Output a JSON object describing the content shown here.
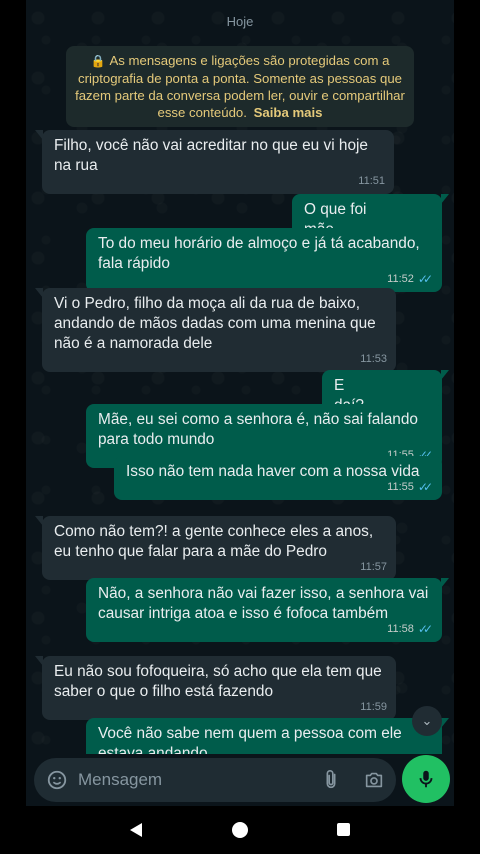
{
  "date_label": "Hoje",
  "encryption_notice": {
    "text": "As mensagens e ligações são protegidas com a criptografia de ponta a ponta. Somente as pessoas que fazem parte da conversa podem ler, ouvir e compartilhar esse conteúdo.",
    "link": "Saiba mais"
  },
  "messages": [
    {
      "direction": "in",
      "text": "Filho, você não vai acreditar no que eu vi hoje na rua",
      "time": "11:51"
    },
    {
      "direction": "out",
      "text": "O que foi mãe",
      "time": "11:51"
    },
    {
      "direction": "out",
      "text": "To do meu horário de almoço e já tá acabando, fala rápido",
      "time": "11:52"
    },
    {
      "direction": "in",
      "text": "Vi o Pedro, filho da moça ali da rua de baixo, andando de mãos dadas com uma menina que não é a namorada dele",
      "time": "11:53"
    },
    {
      "direction": "out",
      "text": "E daí?",
      "time": "11:55"
    },
    {
      "direction": "out",
      "text": "Mãe, eu sei como a senhora é, não sai falando para todo mundo",
      "time": "11:55"
    },
    {
      "direction": "out",
      "text": "Isso não tem nada haver com a nossa vida",
      "time": "11:55"
    },
    {
      "direction": "in",
      "text": "Como não tem?! a gente conhece eles a anos, eu tenho que falar para a mãe do Pedro",
      "time": "11:57"
    },
    {
      "direction": "out",
      "text": "Não, a senhora não vai fazer isso, a senhora vai causar intriga atoa e isso é fofoca também",
      "time": "11:58"
    },
    {
      "direction": "in",
      "text": "Eu não sou fofoqueira, só acho que ela tem que saber o que o filho está fazendo",
      "time": "11:59"
    },
    {
      "direction": "out",
      "text": "Você não sabe nem quem a pessoa com ele estava andando",
      "time": ""
    }
  ],
  "composer": {
    "placeholder": "Mensagem"
  },
  "icons": {
    "emoji": "sticker-emoji-icon",
    "attach": "paperclip-icon",
    "camera": "camera-icon",
    "mic": "microphone-icon",
    "scroll": "chevron-double-down-icon"
  },
  "colors": {
    "background": "#0b141a",
    "incoming_bubble": "#202c33",
    "outgoing_bubble": "#005c4b",
    "read_ticks": "#53bdeb",
    "mic_button": "#21c063",
    "notice_text": "#e4c97a"
  }
}
